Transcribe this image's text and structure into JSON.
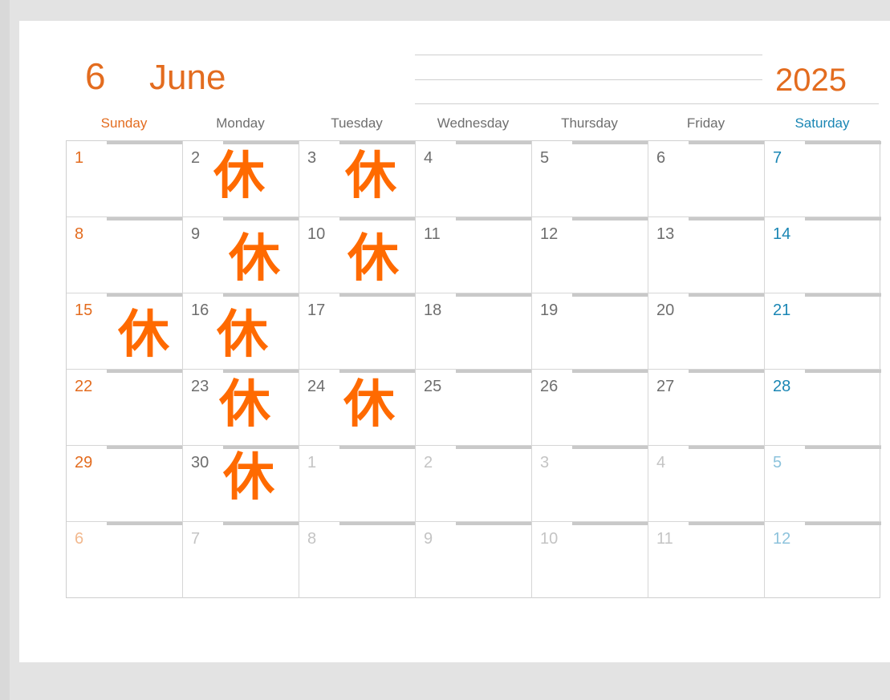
{
  "header": {
    "month_number": "6",
    "month_name": "June",
    "year": "2025"
  },
  "weekdays": [
    "Sunday",
    "Monday",
    "Tuesday",
    "Wednesday",
    "Thursday",
    "Friday",
    "Saturday"
  ],
  "weeks": [
    [
      "1",
      "2",
      "3",
      "4",
      "5",
      "6",
      "7"
    ],
    [
      "8",
      "9",
      "10",
      "11",
      "12",
      "13",
      "14"
    ],
    [
      "15",
      "16",
      "17",
      "18",
      "19",
      "20",
      "21"
    ],
    [
      "22",
      "23",
      "24",
      "25",
      "26",
      "27",
      "28"
    ],
    [
      "29",
      "30",
      "1",
      "2",
      "3",
      "4",
      "5"
    ],
    [
      "6",
      "7",
      "8",
      "9",
      "10",
      "11",
      "12"
    ]
  ],
  "holiday_mark": "休",
  "holidays": [
    "2",
    "3",
    "9",
    "10",
    "15",
    "16",
    "23",
    "24",
    "30"
  ],
  "colors": {
    "accent": "#e36c1f",
    "saturday": "#1a86b4",
    "holiday_mark": "#ff6a00"
  }
}
